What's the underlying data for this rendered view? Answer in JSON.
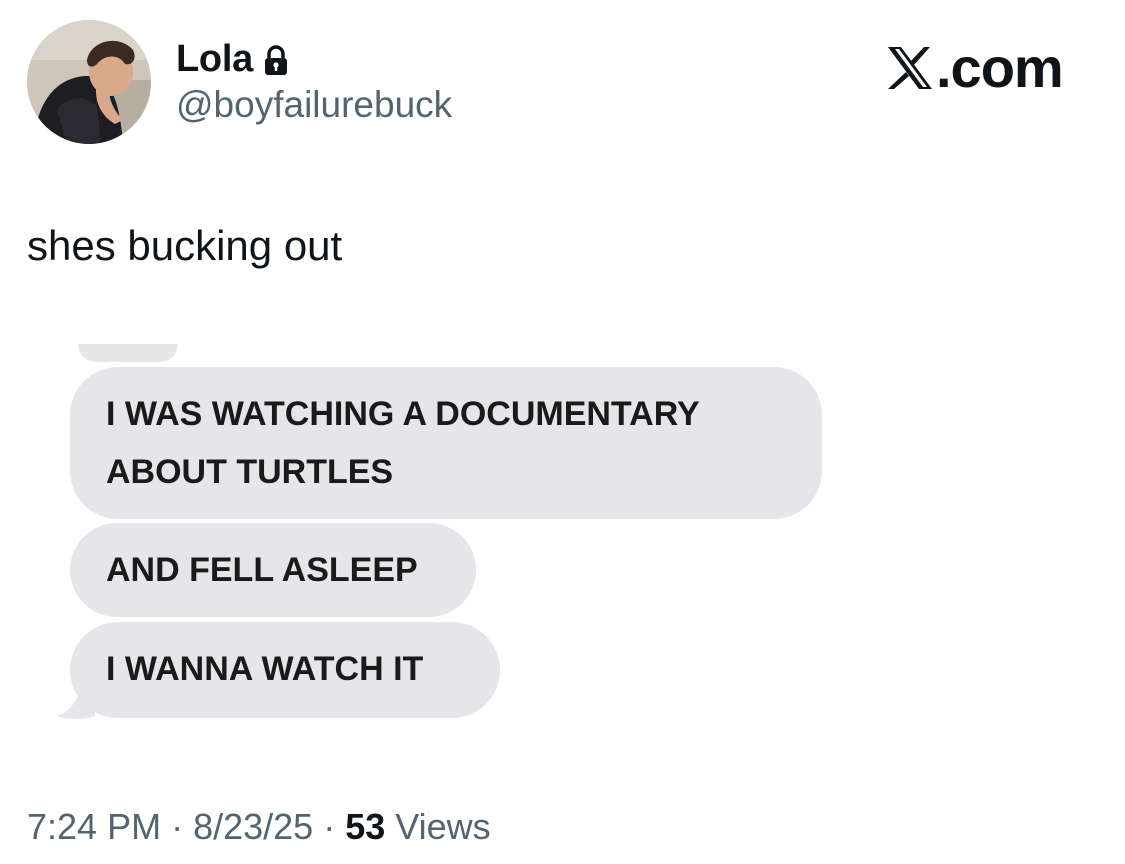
{
  "author": {
    "display_name": "Lola",
    "handle": "@boyfailurebuck",
    "locked_icon": "lock-icon",
    "avatar": "profile-photo"
  },
  "brand": {
    "logo_icon": "x-logo-icon",
    "text": ".com"
  },
  "tweet": {
    "text": "shes bucking out"
  },
  "messages": [
    {
      "text": "I WAS WATCHING A DOCUMENTARY ABOUT TURTLES"
    },
    {
      "text": "AND FELL ASLEEP"
    },
    {
      "text": "I WANNA WATCH IT"
    }
  ],
  "meta": {
    "time": "7:24 PM",
    "separator": " · ",
    "date": "8/23/25",
    "views_count": "53",
    "views_label": " Views"
  },
  "colors": {
    "text_primary": "#0f1419",
    "text_secondary": "#536471",
    "bubble_background": "#e5e5ea"
  }
}
